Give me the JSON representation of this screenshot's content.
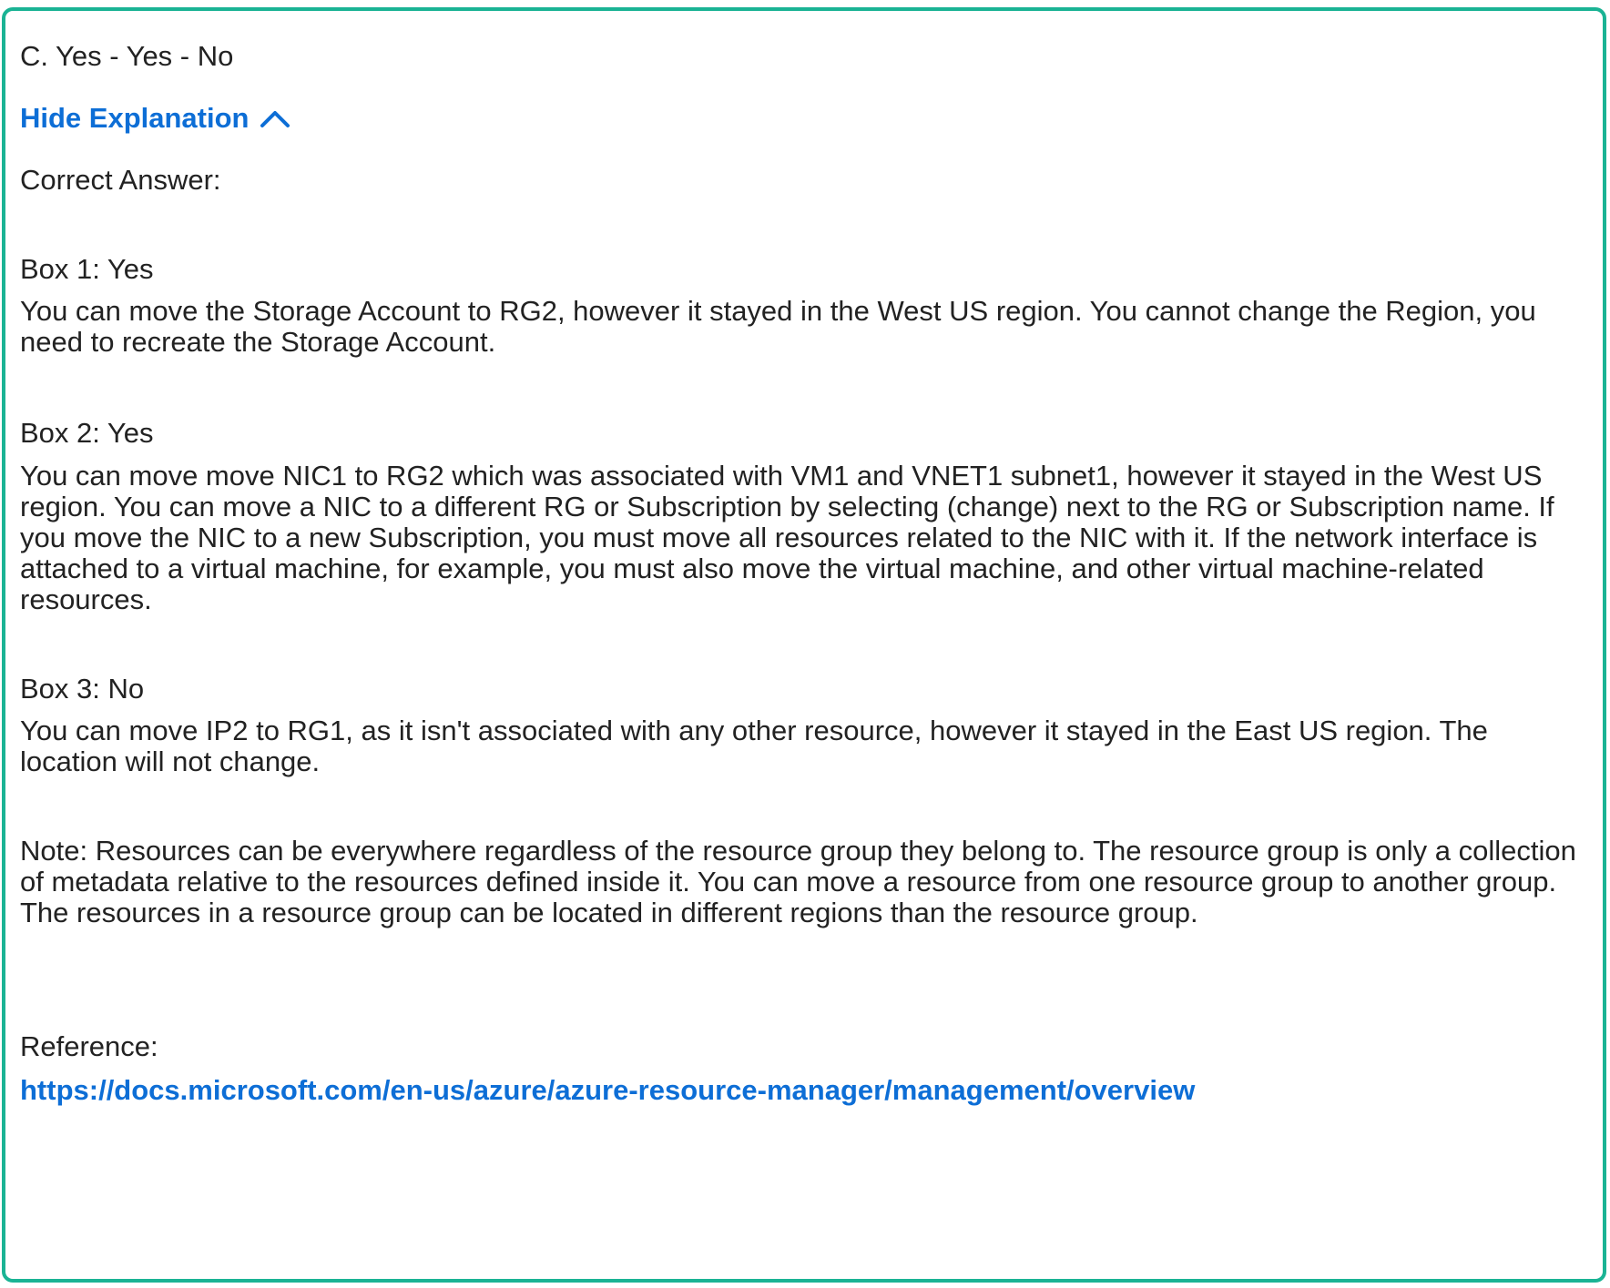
{
  "answer_option": "C. Yes - Yes - No",
  "toggle": {
    "label": "Hide Explanation",
    "icon": "chevron-up-icon"
  },
  "correct_answer_label": "Correct Answer:",
  "boxes": [
    {
      "title": "Box 1: Yes",
      "text": "You can move the Storage Account to RG2, however it stayed in the West US region. You cannot change the Region, you need to recreate the Storage Account."
    },
    {
      "title": "Box 2: Yes",
      "text": "You can move move NIC1 to RG2 which was associated with VM1 and VNET1 subnet1, however it stayed in the West US region. You can move a NIC to a different RG or Subscription by selecting (change) next to the RG or Subscription name. If you move the NIC to a new Subscription, you must move all resources related to the NIC with it. If the network interface is attached to a virtual machine, for example, you must also move the virtual machine, and other virtual machine-related resources."
    },
    {
      "title": "Box 3: No",
      "text": "You can move IP2 to RG1, as it isn't associated with any other resource, however it stayed in the East US region. The location will not change."
    }
  ],
  "note": "Note: Resources can be everywhere regardless of the resource group they belong to. The resource group is only a collection of metadata relative to the resources defined inside it. You can move a resource from one resource group to another group. The resources in a resource group can be located in different regions than the resource group.",
  "reference": {
    "label": "Reference:",
    "url": "https://docs.microsoft.com/en-us/azure/azure-resource-manager/management/overview"
  },
  "colors": {
    "border": "#1ab394",
    "link": "#0d6ed6",
    "text": "#222222"
  }
}
